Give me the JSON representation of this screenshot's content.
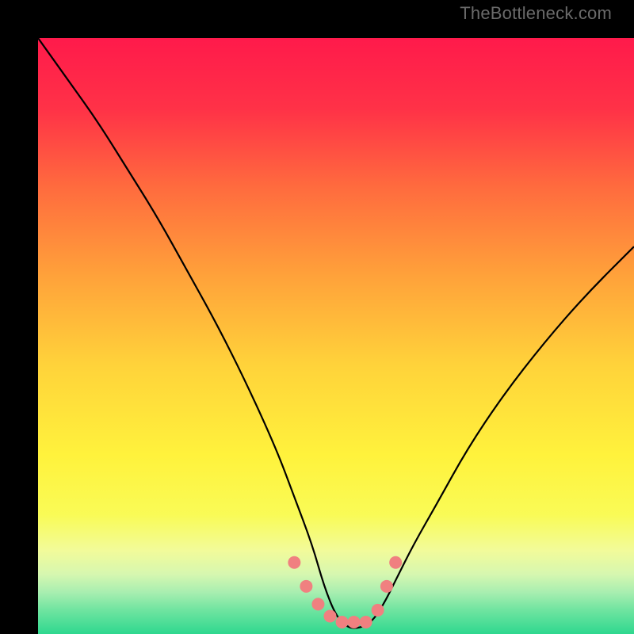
{
  "watermark": "TheBottleneck.com",
  "chart_data": {
    "type": "line",
    "title": "",
    "xlabel": "",
    "ylabel": "",
    "xlim": [
      0,
      100
    ],
    "ylim": [
      0,
      100
    ],
    "grid": false,
    "legend": false,
    "background_gradient_stops": [
      {
        "pct": 0,
        "color": "#ff1a4b"
      },
      {
        "pct": 12,
        "color": "#ff3247"
      },
      {
        "pct": 25,
        "color": "#ff6b3e"
      },
      {
        "pct": 40,
        "color": "#ffa23a"
      },
      {
        "pct": 55,
        "color": "#ffd33a"
      },
      {
        "pct": 70,
        "color": "#fff23c"
      },
      {
        "pct": 80,
        "color": "#f9fb56"
      },
      {
        "pct": 86,
        "color": "#f2fb9a"
      },
      {
        "pct": 90,
        "color": "#d6f7b0"
      },
      {
        "pct": 93,
        "color": "#a8eeb0"
      },
      {
        "pct": 96,
        "color": "#6fe4a0"
      },
      {
        "pct": 100,
        "color": "#2fd88f"
      }
    ],
    "series": [
      {
        "name": "bottleneck-curve",
        "color": "#000000",
        "stroke_width": 2.2,
        "x": [
          0,
          5,
          10,
          15,
          20,
          25,
          30,
          35,
          40,
          43,
          46,
          48,
          50,
          52,
          54,
          56,
          58,
          60,
          63,
          67,
          72,
          78,
          85,
          92,
          100
        ],
        "y": [
          100,
          93,
          86,
          78,
          70,
          61,
          52,
          42,
          31,
          23,
          15,
          8,
          3,
          1,
          1,
          2,
          5,
          9,
          15,
          22,
          31,
          40,
          49,
          57,
          65
        ]
      }
    ],
    "markers": {
      "name": "highlight-dots",
      "color": "#f08080",
      "radius": 8,
      "points": [
        {
          "x": 43,
          "y": 12
        },
        {
          "x": 45,
          "y": 8
        },
        {
          "x": 47,
          "y": 5
        },
        {
          "x": 49,
          "y": 3
        },
        {
          "x": 51,
          "y": 2
        },
        {
          "x": 53,
          "y": 2
        },
        {
          "x": 55,
          "y": 2
        },
        {
          "x": 57,
          "y": 4
        },
        {
          "x": 58.5,
          "y": 8
        },
        {
          "x": 60,
          "y": 12
        }
      ]
    }
  }
}
